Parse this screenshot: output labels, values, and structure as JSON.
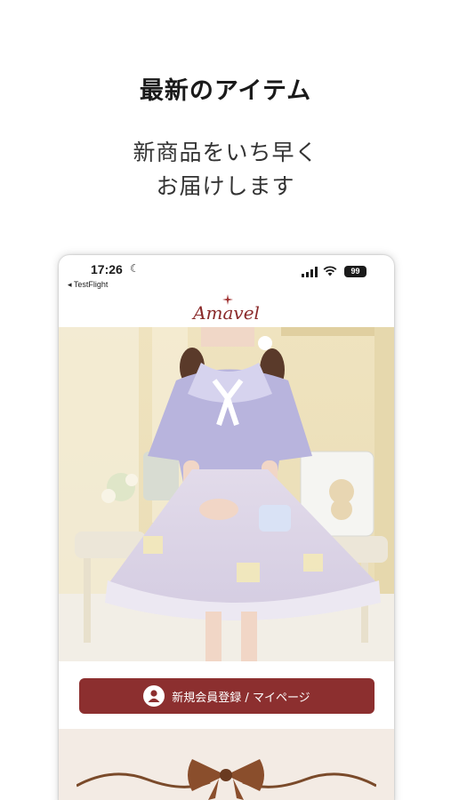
{
  "promo": {
    "headline": "最新のアイテム",
    "subline_1": "新商品をいち早く",
    "subline_2": "お届けします"
  },
  "status_bar": {
    "time": "17:26",
    "back_app": "◂ TestFlight",
    "battery": "99",
    "icons": [
      "moon-icon",
      "signal-icon",
      "wifi-icon",
      "battery-icon"
    ]
  },
  "app": {
    "logo": "Amavel",
    "cta_label": "新規会員登録 / マイページ",
    "colors": {
      "brand": "#8c2f2f",
      "band": "#f3ebe4"
    }
  }
}
